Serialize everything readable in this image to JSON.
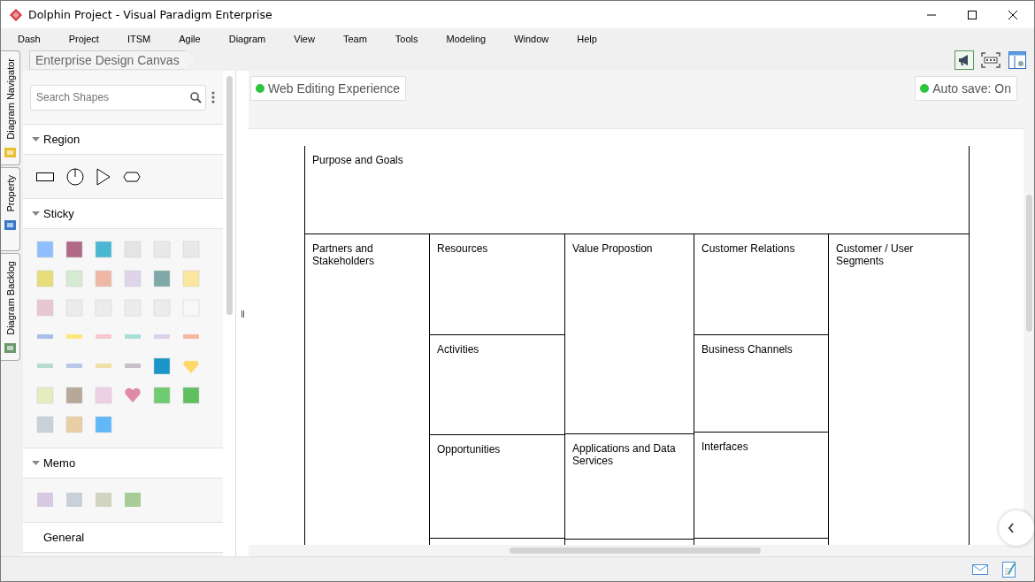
{
  "window": {
    "title": "Dolphin Project - Visual Paradigm Enterprise"
  },
  "menu": [
    "Dash",
    "Project",
    "ITSM",
    "Agile",
    "Diagram",
    "View",
    "Team",
    "Tools",
    "Modeling",
    "Window",
    "Help"
  ],
  "side_tabs": [
    {
      "label": "Diagram Navigator"
    },
    {
      "label": "Property"
    },
    {
      "label": "Diagram Backlog"
    }
  ],
  "breadcrumb": "Enterprise Design Canvas",
  "search": {
    "placeholder": "Search Shapes"
  },
  "palette": [
    {
      "title": "Region",
      "expanded": true,
      "kind": "region"
    },
    {
      "title": "Sticky",
      "expanded": true,
      "kind": "sticky"
    },
    {
      "title": "Memo",
      "expanded": true,
      "kind": "memo"
    },
    {
      "title": "General",
      "kind": "general"
    }
  ],
  "status_chips": [
    {
      "label": "Web Editing Experience",
      "on": true
    },
    {
      "label": "Auto save: On",
      "on": true
    }
  ],
  "canvas": {
    "top": "Purpose and Goals",
    "columns": [
      {
        "cells": [
          "Partners and Stakeholders"
        ]
      },
      {
        "cells": [
          "Resources",
          "Activities",
          "Opportunities"
        ]
      },
      {
        "cells": [
          "Value Propostion",
          "Applications and Data Services"
        ]
      },
      {
        "cells": [
          "Customer Relations",
          "Business Channels",
          "Interfaces"
        ]
      },
      {
        "cells": [
          "Customer / User Segments"
        ]
      }
    ]
  }
}
